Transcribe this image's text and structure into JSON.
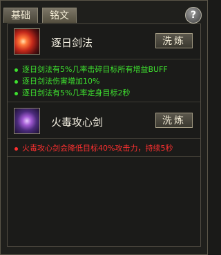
{
  "tabs": [
    "基础",
    "铭文"
  ],
  "help_label": "?",
  "skills": [
    {
      "name": "逐日剑法",
      "button": "洗炼",
      "icon": "sun-sword-icon",
      "effects": [
        "逐日剑法有5%几率击碎目标所有增益BUFF",
        "逐日剑法伤害增加10%",
        "逐日剑法有5%几率定身目标2秒"
      ],
      "effect_color": "#3ee12f"
    },
    {
      "name": "火毒攻心剑",
      "button": "洗炼",
      "icon": "poison-sword-icon",
      "effects": [
        "火毒攻心剑会降低目标40%攻击力，持续5秒"
      ],
      "effect_color": "#ff3030"
    }
  ]
}
